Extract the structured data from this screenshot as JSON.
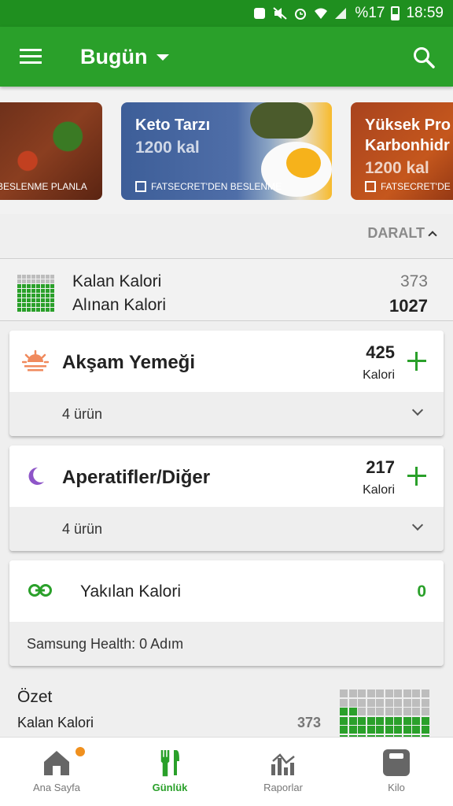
{
  "status_bar": {
    "battery": "%17",
    "time": "18:59"
  },
  "app_bar": {
    "title": "Bugün"
  },
  "carousel": [
    {
      "title": "",
      "kal": "",
      "footer": "N BESLENME PLANLA"
    },
    {
      "title": "Keto Tarzı",
      "kal": "1200 kal",
      "footer": "FATSECRET'DEN BESLENME"
    },
    {
      "title": "Yüksek Pro\nKarbonhidr",
      "kal": "1200 kal",
      "footer": "FATSECRET'DE"
    }
  ],
  "collapse_label": "DARALT",
  "calories": {
    "remaining_label": "Kalan Kalori",
    "remaining_value": "373",
    "consumed_label": "Alınan Kalori",
    "consumed_value": "1027"
  },
  "meals": [
    {
      "name": "Akşam Yemeği",
      "value": "425",
      "unit": "Kalori",
      "count": "4 ürün",
      "icon": "sunset-icon"
    },
    {
      "name": "Aperatifler/Diğer",
      "value": "217",
      "unit": "Kalori",
      "count": "4 ürün",
      "icon": "moon-icon"
    }
  ],
  "burned": {
    "label": "Yakılan Kalori",
    "value": "0",
    "source": "Samsung Health: 0 Adım"
  },
  "summary": {
    "title": "Özet",
    "remaining_label": "Kalan Kalori",
    "remaining_value": "373"
  },
  "bottom_nav": [
    {
      "label": "Ana Sayfa",
      "icon": "home-icon"
    },
    {
      "label": "Günlük",
      "icon": "fork-knife-icon"
    },
    {
      "label": "Raporlar",
      "icon": "chart-icon"
    },
    {
      "label": "Kilo",
      "icon": "scale-icon"
    }
  ],
  "colors": {
    "primary": "#2aa02a",
    "status_bar": "#1f8f1f",
    "badge": "#f0901e"
  }
}
